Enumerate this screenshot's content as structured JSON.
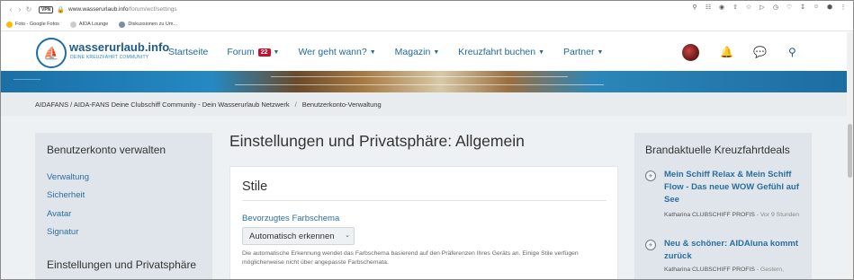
{
  "browser": {
    "url_host": "www.wasserurlaub.info",
    "url_path": "/forum/wcf/settings",
    "vpn_label": "VPN",
    "bookmarks": [
      {
        "label": "Foto - Google Fotos",
        "color": "#fbbc05"
      },
      {
        "label": "AIDA Lounge",
        "color": "#cccccc"
      },
      {
        "label": "Diskussionen zu Um...",
        "color": "#7b8ea8"
      }
    ]
  },
  "site": {
    "logo_title": "wasserurlaub.info",
    "logo_subtitle": "DEINE KREUZFAHRT COMMUNITY",
    "nav": [
      {
        "label": "Startseite"
      },
      {
        "label": "Forum",
        "badge": "22"
      },
      {
        "label": "Wer geht wann?"
      },
      {
        "label": "Magazin"
      },
      {
        "label": "Kreuzfahrt buchen"
      },
      {
        "label": "Partner"
      }
    ]
  },
  "breadcrumb": {
    "item1": "AIDAFANS / AIDA-FANS Deine Clubschiff Community - Dein Wasserurlaub Netzwerk",
    "separator": "/",
    "item2": "Benutzerkonto-Verwaltung"
  },
  "sidebar": {
    "title": "Benutzerkonto verwalten",
    "links": [
      "Verwaltung",
      "Sicherheit",
      "Avatar",
      "Signatur"
    ],
    "section2_title": "Einstellungen und Privatsphäre"
  },
  "main": {
    "page_title": "Einstellungen und Privatsphäre: Allgemein",
    "section_title": "Stile",
    "field_label": "Bevorzugtes Farbschema",
    "select_value": "Automatisch erkennen",
    "help_text": "Die automatische Erkennung wendet das Farbschema basierend auf den Präferenzen Ihres Geräts an. Einige Stile verfügen möglicherweise nicht über angepasste Farbschemata."
  },
  "deals": {
    "title": "Brandaktuelle Kreuzfahrtdeals",
    "items": [
      {
        "title": "Mein Schiff Relax & Mein Schiff Flow - Das neue WOW Gefühl auf See",
        "author": "Katharina CLUBSCHIFF PROFIS",
        "time": "- Vor 9 Stunden"
      },
      {
        "title": "Neu & schöner: AIDAluna kommt zurück",
        "author": "Katharina CLUBSCHIFF PROFIS",
        "time": "- Gestern,"
      }
    ]
  }
}
